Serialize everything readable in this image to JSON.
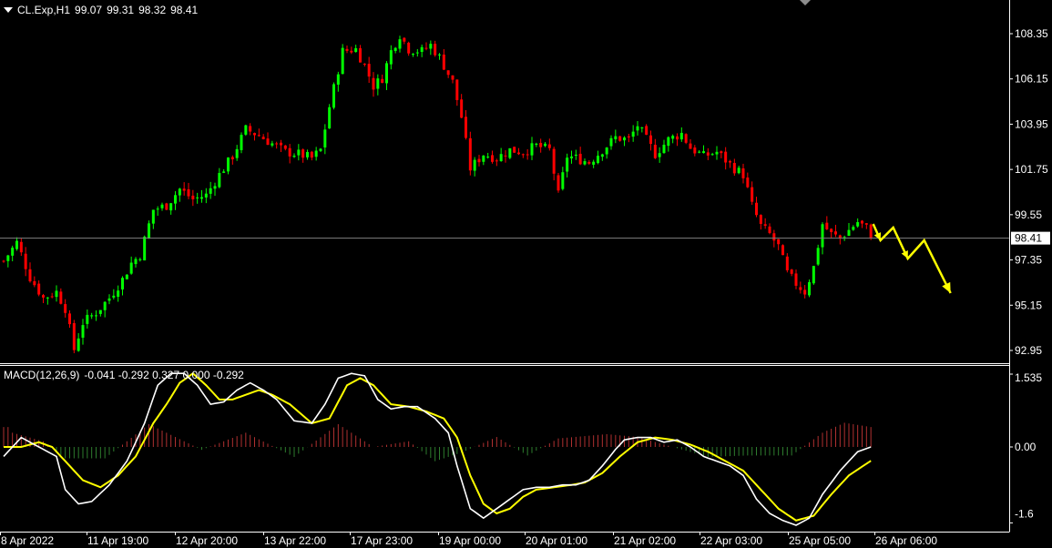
{
  "header": {
    "symbol": "CL.Exp,H1",
    "open": "99.07",
    "high": "99.31",
    "low": "98.32",
    "close": "98.41"
  },
  "macd_header": {
    "label": "MACD(12,26,9)",
    "values": "-0.041 -0.292 0.327 0.000 -0.292"
  },
  "colors": {
    "background": "#000000",
    "bull_candle": "#00ff00",
    "bear_candle": "#ff0000",
    "axis": "#ffffff",
    "price_line": "#808080",
    "macd_line": "#ffffff",
    "signal_line": "#ffff00",
    "hist_positive": "#b03030",
    "hist_negative": "#2e7d2e",
    "annotation": "#ffff00"
  },
  "chart_data": [
    {
      "type": "candlestick",
      "title": "CL.Exp,H1",
      "y_ticks": [
        "108.35",
        "106.15",
        "103.95",
        "101.75",
        "99.55",
        "97.35",
        "95.15",
        "92.95"
      ],
      "ylim": [
        92.45,
        109.8
      ],
      "current_price": "98.41",
      "x_ticks": [
        "8 Apr 2022",
        "11 Apr 19:00",
        "12 Apr 20:00",
        "13 Apr 22:00",
        "17 Apr 23:00",
        "19 Apr 00:00",
        "20 Apr 01:00",
        "21 Apr 02:00",
        "22 Apr 03:00",
        "25 Apr 05:00",
        "26 Apr 06:00"
      ],
      "path": [
        [
          0,
          97.3
        ],
        [
          3,
          98.2
        ],
        [
          6,
          96.5
        ],
        [
          9,
          95.5
        ],
        [
          12,
          95.8
        ],
        [
          14,
          95.0
        ],
        [
          16,
          93.0
        ],
        [
          18,
          94.3
        ],
        [
          21,
          94.8
        ],
        [
          24,
          95.5
        ],
        [
          27,
          96.4
        ],
        [
          29,
          97.2
        ],
        [
          31,
          97.6
        ],
        [
          34,
          99.8
        ],
        [
          37,
          100.0
        ],
        [
          40,
          100.8
        ],
        [
          43,
          100.3
        ],
        [
          46,
          100.5
        ],
        [
          49,
          101.5
        ],
        [
          52,
          102.4
        ],
        [
          55,
          103.7
        ],
        [
          58,
          103.4
        ],
        [
          61,
          103.0
        ],
        [
          64,
          102.6
        ],
        [
          67,
          102.5
        ],
        [
          70,
          102.3
        ],
        [
          72,
          102.7
        ],
        [
          74,
          104.8
        ],
        [
          77,
          107.5
        ],
        [
          80,
          107.6
        ],
        [
          82,
          106.8
        ],
        [
          84,
          105.8
        ],
        [
          86,
          106.2
        ],
        [
          88,
          107.5
        ],
        [
          90,
          108.3
        ],
        [
          92,
          107.6
        ],
        [
          95,
          107.5
        ],
        [
          97,
          107.8
        ],
        [
          99,
          107.2
        ],
        [
          102,
          106.0
        ],
        [
          104,
          104.3
        ],
        [
          106,
          101.8
        ],
        [
          109,
          102.5
        ],
        [
          112,
          102.3
        ],
        [
          115,
          102.7
        ],
        [
          118,
          102.6
        ],
        [
          121,
          102.9
        ],
        [
          124,
          102.7
        ],
        [
          126,
          100.5
        ],
        [
          128,
          102.4
        ],
        [
          130,
          102.3
        ],
        [
          133,
          102.1
        ],
        [
          136,
          102.7
        ],
        [
          139,
          103.3
        ],
        [
          142,
          103.2
        ],
        [
          144,
          103.9
        ],
        [
          146,
          103.2
        ],
        [
          148,
          102.5
        ],
        [
          151,
          103.2
        ],
        [
          154,
          103.5
        ],
        [
          156,
          102.8
        ],
        [
          159,
          102.4
        ],
        [
          162,
          102.6
        ],
        [
          164,
          102.2
        ],
        [
          166,
          101.8
        ],
        [
          168,
          101.5
        ],
        [
          170,
          100.0
        ],
        [
          172,
          99.0
        ],
        [
          174,
          98.6
        ],
        [
          176,
          98.0
        ],
        [
          178,
          96.7
        ],
        [
          180,
          96.2
        ],
        [
          182,
          95.8
        ],
        [
          184,
          97.0
        ],
        [
          186,
          99.1
        ],
        [
          188,
          98.6
        ],
        [
          190,
          98.4
        ],
        [
          192,
          98.8
        ],
        [
          194,
          99.2
        ],
        [
          196,
          98.9
        ],
        [
          197,
          98.41
        ]
      ],
      "annotation_arrow": [
        [
          958.67,
          246
        ],
        [
          966.67,
          264
        ],
        [
          980.67,
          250
        ],
        [
          996.67,
          284
        ],
        [
          1014.67,
          264
        ],
        [
          1043.67,
          322
        ]
      ]
    },
    {
      "type": "macd",
      "title": "MACD(12,26,9)",
      "y_ticks": [
        "1.535",
        "0.00",
        "-1.6"
      ],
      "ylim": [
        -1.6,
        1.535
      ],
      "macd": [
        [
          0,
          -0.2
        ],
        [
          4,
          0.2
        ],
        [
          8,
          0.0
        ],
        [
          10,
          -0.1
        ],
        [
          12,
          -0.2
        ],
        [
          14,
          -0.9
        ],
        [
          17,
          -1.2
        ],
        [
          20,
          -1.15
        ],
        [
          24,
          -0.8
        ],
        [
          28,
          -0.3
        ],
        [
          32,
          0.5
        ],
        [
          35,
          1.3
        ],
        [
          38,
          1.55
        ],
        [
          41,
          1.55
        ],
        [
          44,
          1.3
        ],
        [
          47,
          0.9
        ],
        [
          50,
          0.95
        ],
        [
          53,
          1.2
        ],
        [
          56,
          1.35
        ],
        [
          59,
          1.2
        ],
        [
          62,
          1.0
        ],
        [
          66,
          0.55
        ],
        [
          70,
          0.5
        ],
        [
          73,
          0.9
        ],
        [
          76,
          1.45
        ],
        [
          79,
          1.55
        ],
        [
          82,
          1.5
        ],
        [
          85,
          1.0
        ],
        [
          88,
          0.8
        ],
        [
          91,
          0.85
        ],
        [
          94,
          0.85
        ],
        [
          98,
          0.6
        ],
        [
          101,
          0.3
        ],
        [
          103,
          -0.4
        ],
        [
          106,
          -1.3
        ],
        [
          109,
          -1.5
        ],
        [
          112,
          -1.3
        ],
        [
          115,
          -1.1
        ],
        [
          118,
          -0.9
        ],
        [
          121,
          -0.85
        ],
        [
          124,
          -0.85
        ],
        [
          127,
          -0.8
        ],
        [
          130,
          -0.8
        ],
        [
          133,
          -0.7
        ],
        [
          136,
          -0.4
        ],
        [
          139,
          -0.05
        ],
        [
          141,
          0.15
        ],
        [
          144,
          0.2
        ],
        [
          147,
          0.2
        ],
        [
          150,
          0.1
        ],
        [
          153,
          0.15
        ],
        [
          156,
          0.0
        ],
        [
          159,
          -0.2
        ],
        [
          162,
          -0.3
        ],
        [
          165,
          -0.4
        ],
        [
          168,
          -0.6
        ],
        [
          171,
          -1.1
        ],
        [
          174,
          -1.4
        ],
        [
          177,
          -1.55
        ],
        [
          180,
          -1.65
        ],
        [
          183,
          -1.5
        ],
        [
          186,
          -1.0
        ],
        [
          190,
          -0.5
        ],
        [
          194,
          -0.1
        ],
        [
          197,
          0.0
        ]
      ],
      "signal": [
        [
          0,
          0.0
        ],
        [
          4,
          0.0
        ],
        [
          8,
          0.1
        ],
        [
          11,
          0.0
        ],
        [
          14,
          -0.3
        ],
        [
          18,
          -0.7
        ],
        [
          22,
          -0.85
        ],
        [
          26,
          -0.6
        ],
        [
          30,
          -0.2
        ],
        [
          34,
          0.5
        ],
        [
          37,
          0.9
        ],
        [
          40,
          1.35
        ],
        [
          43,
          1.55
        ],
        [
          46,
          1.3
        ],
        [
          49,
          1.0
        ],
        [
          52,
          1.0
        ],
        [
          55,
          1.1
        ],
        [
          58,
          1.2
        ],
        [
          61,
          1.1
        ],
        [
          65,
          0.9
        ],
        [
          70,
          0.5
        ],
        [
          74,
          0.6
        ],
        [
          78,
          1.3
        ],
        [
          81,
          1.45
        ],
        [
          84,
          1.3
        ],
        [
          88,
          0.9
        ],
        [
          92,
          0.85
        ],
        [
          96,
          0.75
        ],
        [
          100,
          0.6
        ],
        [
          103,
          0.2
        ],
        [
          106,
          -0.6
        ],
        [
          109,
          -1.2
        ],
        [
          112,
          -1.4
        ],
        [
          115,
          -1.3
        ],
        [
          118,
          -1.05
        ],
        [
          121,
          -0.9
        ],
        [
          125,
          -0.85
        ],
        [
          129,
          -0.8
        ],
        [
          132,
          -0.75
        ],
        [
          136,
          -0.55
        ],
        [
          140,
          -0.2
        ],
        [
          144,
          0.1
        ],
        [
          148,
          0.2
        ],
        [
          152,
          0.15
        ],
        [
          156,
          0.05
        ],
        [
          160,
          -0.1
        ],
        [
          164,
          -0.3
        ],
        [
          168,
          -0.5
        ],
        [
          172,
          -0.9
        ],
        [
          176,
          -1.3
        ],
        [
          180,
          -1.55
        ],
        [
          184,
          -1.45
        ],
        [
          188,
          -1.0
        ],
        [
          192,
          -0.6
        ],
        [
          197,
          -0.292
        ]
      ],
      "histogram_bumps": [
        [
          2,
          -0.05,
          0.5
        ],
        [
          9,
          -0.1,
          0.2
        ],
        [
          14,
          -0.2,
          -0.4
        ],
        [
          23,
          0.15,
          -0.4
        ],
        [
          33,
          0.6,
          0.8
        ],
        [
          45,
          0.3,
          -0.1
        ],
        [
          55,
          0.0,
          0.5
        ],
        [
          66,
          -0.05,
          -0.35
        ],
        [
          76,
          0.4,
          0.8
        ],
        [
          84,
          0.3,
          0.0
        ],
        [
          92,
          -0.2,
          0.2
        ],
        [
          98,
          0.0,
          -0.5
        ],
        [
          104,
          0.0,
          -0.2
        ],
        [
          112,
          0.1,
          0.35
        ],
        [
          119,
          -0.05,
          -0.3
        ],
        [
          126,
          0.05,
          0.3
        ],
        [
          137,
          0.0,
          0.45
        ],
        [
          144,
          -0.02,
          0.35
        ],
        [
          160,
          -0.12,
          -0.35
        ],
        [
          169,
          -0.3,
          -0.3
        ],
        [
          179,
          -0.3,
          -0.3
        ],
        [
          186,
          0.05,
          0.5
        ],
        [
          191,
          0.2,
          0.85
        ],
        [
          197,
          0.0,
          0.7
        ]
      ]
    }
  ]
}
